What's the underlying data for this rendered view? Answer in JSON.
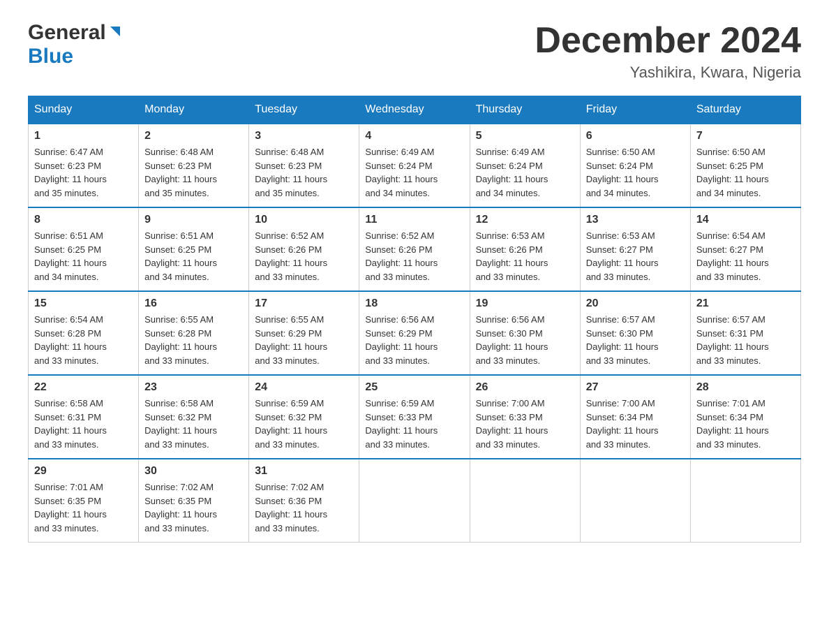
{
  "header": {
    "logo_general": "General",
    "logo_blue": "Blue",
    "month_title": "December 2024",
    "location": "Yashikira, Kwara, Nigeria"
  },
  "weekdays": [
    "Sunday",
    "Monday",
    "Tuesday",
    "Wednesday",
    "Thursday",
    "Friday",
    "Saturday"
  ],
  "weeks": [
    [
      {
        "day": "1",
        "sunrise": "6:47 AM",
        "sunset": "6:23 PM",
        "daylight": "11 hours and 35 minutes."
      },
      {
        "day": "2",
        "sunrise": "6:48 AM",
        "sunset": "6:23 PM",
        "daylight": "11 hours and 35 minutes."
      },
      {
        "day": "3",
        "sunrise": "6:48 AM",
        "sunset": "6:23 PM",
        "daylight": "11 hours and 35 minutes."
      },
      {
        "day": "4",
        "sunrise": "6:49 AM",
        "sunset": "6:24 PM",
        "daylight": "11 hours and 34 minutes."
      },
      {
        "day": "5",
        "sunrise": "6:49 AM",
        "sunset": "6:24 PM",
        "daylight": "11 hours and 34 minutes."
      },
      {
        "day": "6",
        "sunrise": "6:50 AM",
        "sunset": "6:24 PM",
        "daylight": "11 hours and 34 minutes."
      },
      {
        "day": "7",
        "sunrise": "6:50 AM",
        "sunset": "6:25 PM",
        "daylight": "11 hours and 34 minutes."
      }
    ],
    [
      {
        "day": "8",
        "sunrise": "6:51 AM",
        "sunset": "6:25 PM",
        "daylight": "11 hours and 34 minutes."
      },
      {
        "day": "9",
        "sunrise": "6:51 AM",
        "sunset": "6:25 PM",
        "daylight": "11 hours and 34 minutes."
      },
      {
        "day": "10",
        "sunrise": "6:52 AM",
        "sunset": "6:26 PM",
        "daylight": "11 hours and 33 minutes."
      },
      {
        "day": "11",
        "sunrise": "6:52 AM",
        "sunset": "6:26 PM",
        "daylight": "11 hours and 33 minutes."
      },
      {
        "day": "12",
        "sunrise": "6:53 AM",
        "sunset": "6:26 PM",
        "daylight": "11 hours and 33 minutes."
      },
      {
        "day": "13",
        "sunrise": "6:53 AM",
        "sunset": "6:27 PM",
        "daylight": "11 hours and 33 minutes."
      },
      {
        "day": "14",
        "sunrise": "6:54 AM",
        "sunset": "6:27 PM",
        "daylight": "11 hours and 33 minutes."
      }
    ],
    [
      {
        "day": "15",
        "sunrise": "6:54 AM",
        "sunset": "6:28 PM",
        "daylight": "11 hours and 33 minutes."
      },
      {
        "day": "16",
        "sunrise": "6:55 AM",
        "sunset": "6:28 PM",
        "daylight": "11 hours and 33 minutes."
      },
      {
        "day": "17",
        "sunrise": "6:55 AM",
        "sunset": "6:29 PM",
        "daylight": "11 hours and 33 minutes."
      },
      {
        "day": "18",
        "sunrise": "6:56 AM",
        "sunset": "6:29 PM",
        "daylight": "11 hours and 33 minutes."
      },
      {
        "day": "19",
        "sunrise": "6:56 AM",
        "sunset": "6:30 PM",
        "daylight": "11 hours and 33 minutes."
      },
      {
        "day": "20",
        "sunrise": "6:57 AM",
        "sunset": "6:30 PM",
        "daylight": "11 hours and 33 minutes."
      },
      {
        "day": "21",
        "sunrise": "6:57 AM",
        "sunset": "6:31 PM",
        "daylight": "11 hours and 33 minutes."
      }
    ],
    [
      {
        "day": "22",
        "sunrise": "6:58 AM",
        "sunset": "6:31 PM",
        "daylight": "11 hours and 33 minutes."
      },
      {
        "day": "23",
        "sunrise": "6:58 AM",
        "sunset": "6:32 PM",
        "daylight": "11 hours and 33 minutes."
      },
      {
        "day": "24",
        "sunrise": "6:59 AM",
        "sunset": "6:32 PM",
        "daylight": "11 hours and 33 minutes."
      },
      {
        "day": "25",
        "sunrise": "6:59 AM",
        "sunset": "6:33 PM",
        "daylight": "11 hours and 33 minutes."
      },
      {
        "day": "26",
        "sunrise": "7:00 AM",
        "sunset": "6:33 PM",
        "daylight": "11 hours and 33 minutes."
      },
      {
        "day": "27",
        "sunrise": "7:00 AM",
        "sunset": "6:34 PM",
        "daylight": "11 hours and 33 minutes."
      },
      {
        "day": "28",
        "sunrise": "7:01 AM",
        "sunset": "6:34 PM",
        "daylight": "11 hours and 33 minutes."
      }
    ],
    [
      {
        "day": "29",
        "sunrise": "7:01 AM",
        "sunset": "6:35 PM",
        "daylight": "11 hours and 33 minutes."
      },
      {
        "day": "30",
        "sunrise": "7:02 AM",
        "sunset": "6:35 PM",
        "daylight": "11 hours and 33 minutes."
      },
      {
        "day": "31",
        "sunrise": "7:02 AM",
        "sunset": "6:36 PM",
        "daylight": "11 hours and 33 minutes."
      },
      null,
      null,
      null,
      null
    ]
  ],
  "labels": {
    "sunrise": "Sunrise:",
    "sunset": "Sunset:",
    "daylight": "Daylight:"
  }
}
